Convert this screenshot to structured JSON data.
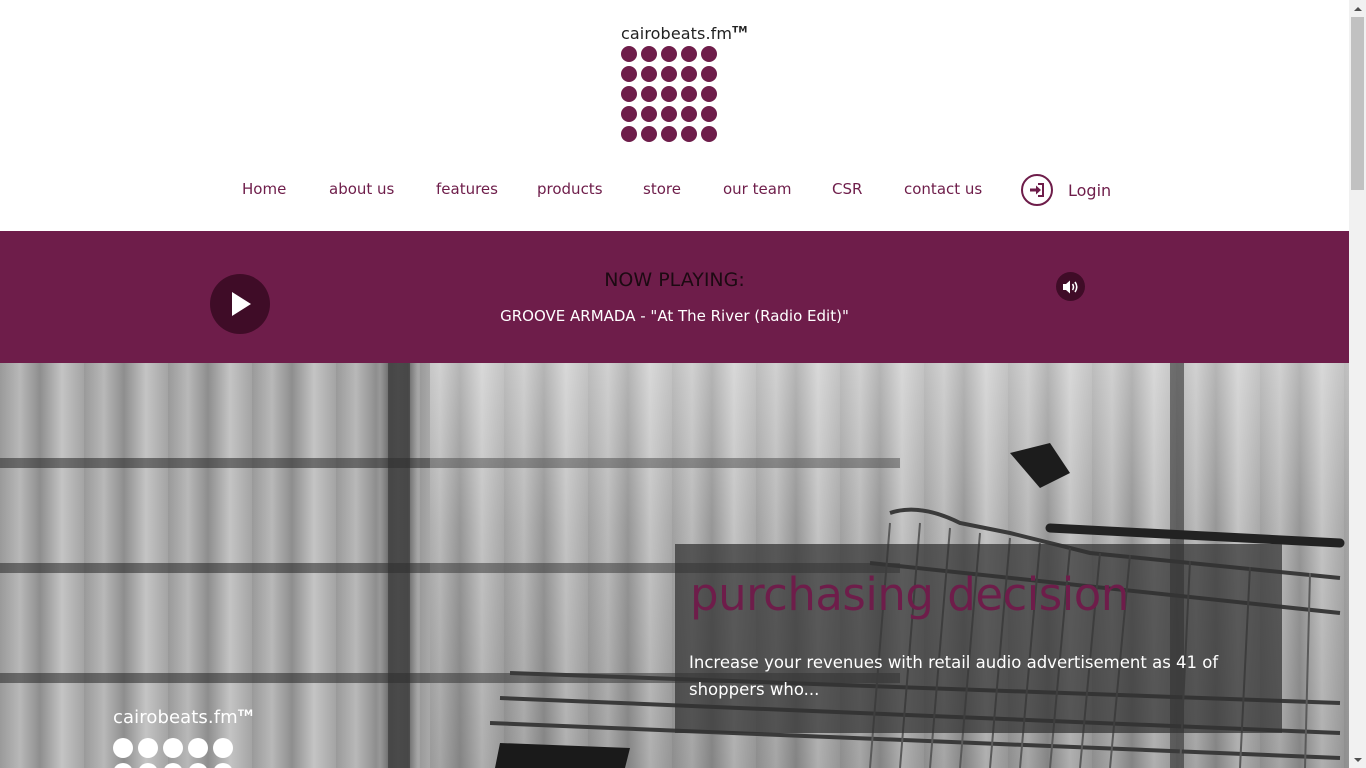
{
  "brand": {
    "name": "cairobeats.fm",
    "trademark": "TM",
    "accent_color": "#6e1d4a",
    "dark_accent": "#3f0c27"
  },
  "nav": {
    "items": [
      {
        "label": "Home"
      },
      {
        "label": "about us"
      },
      {
        "label": "features"
      },
      {
        "label": "products"
      },
      {
        "label": "store"
      },
      {
        "label": "our team"
      },
      {
        "label": "CSR"
      },
      {
        "label": "contact us"
      }
    ],
    "login_icon": "sign-in-icon",
    "login_label": "Login"
  },
  "player": {
    "now_playing_label": "NOW PLAYING:",
    "track": "GROOVE ARMADA - \"At The River (Radio Edit)\"",
    "play_icon": "play-icon",
    "volume_icon": "volume-icon"
  },
  "hero": {
    "heading": "purchasing decision",
    "body": "Increase your revenues with retail audio advertisement as 41 of shoppers who...",
    "logo_text": "cairobeats.fm",
    "logo_tm": "TM"
  }
}
